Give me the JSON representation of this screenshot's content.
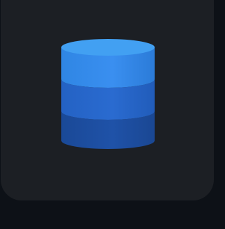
{
  "app_icon": {
    "icon": "database-icon",
    "colors": {
      "background": "#0d1117",
      "tile": "#1c1f24",
      "top_ellipse": "#42a0f2",
      "layer_top": "#2f80df",
      "layer_middle": "#2464c4",
      "layer_bottom": "#1b4b9c"
    }
  }
}
